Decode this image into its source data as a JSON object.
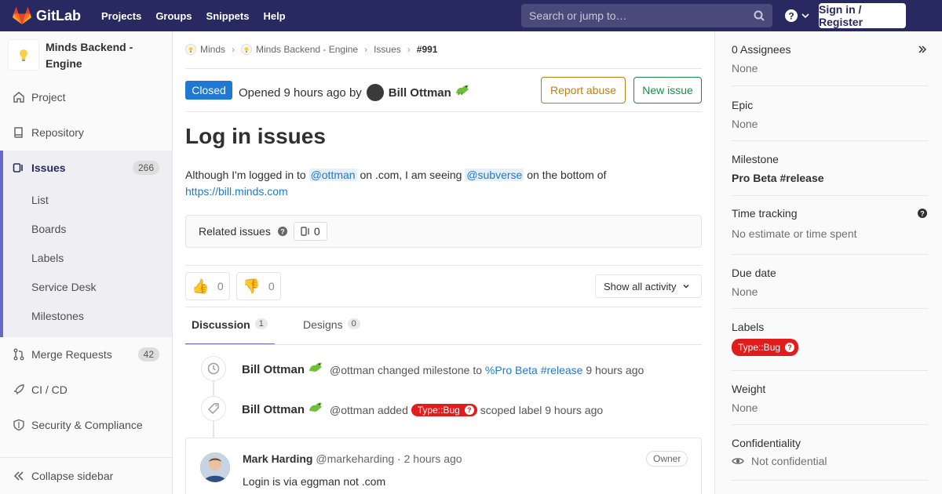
{
  "app": {
    "name": "GitLab"
  },
  "topnav": {
    "links": [
      "Projects",
      "Groups",
      "Snippets",
      "Help"
    ],
    "search_placeholder": "Search or jump to…",
    "signin": "Sign in / Register"
  },
  "sidebar": {
    "project_name": "Minds Backend - Engine",
    "items": {
      "project": "Project",
      "repository": "Repository",
      "issues": "Issues",
      "issues_count": "266",
      "merge_requests": "Merge Requests",
      "merge_requests_count": "42",
      "cicd": "CI / CD",
      "security": "Security & Compliance"
    },
    "issue_subitems": [
      "List",
      "Boards",
      "Labels",
      "Service Desk",
      "Milestones"
    ],
    "collapse": "Collapse sidebar"
  },
  "breadcrumb": [
    "Minds",
    "Minds Backend - Engine",
    "Issues",
    "#991"
  ],
  "issue": {
    "status": "Closed",
    "opened_text": "Opened 9 hours ago by",
    "author": "Bill Ottman",
    "report_abuse": "Report abuse",
    "new_issue": "New issue",
    "title": "Log in issues",
    "desc_1": "Although I'm logged in to",
    "mention_1": "@ottman",
    "desc_2": "on .com, I am seeing",
    "mention_2": "@subverse",
    "desc_3": "on the bottom of",
    "link": "https://bill.minds.com",
    "related_label": "Related issues",
    "related_count": "0",
    "thumbs_up": "0",
    "thumbs_down": "0",
    "activity_filter": "Show all activity"
  },
  "tabs": {
    "discussion": "Discussion",
    "discussion_count": "1",
    "designs": "Designs",
    "designs_count": "0"
  },
  "timeline": [
    {
      "author": "Bill Ottman",
      "handle": "@ottman",
      "action": "changed milestone to",
      "target": "%Pro Beta #release",
      "time": "9 hours ago"
    },
    {
      "author": "Bill Ottman",
      "handle": "@ottman",
      "action": "added",
      "label": "Type::Bug",
      "suffix": "scoped label",
      "time": "9 hours ago"
    }
  ],
  "note": {
    "author": "Mark Harding",
    "handle": "@markeharding · 2 hours ago",
    "role": "Owner",
    "body": "Login is via eggman not .com"
  },
  "right_sidebar": {
    "assignees_title": "0 Assignees",
    "assignees_value": "None",
    "epic_title": "Epic",
    "epic_value": "None",
    "milestone_title": "Milestone",
    "milestone_value": "Pro Beta #release",
    "time_title": "Time tracking",
    "time_value": "No estimate or time spent",
    "due_title": "Due date",
    "due_value": "None",
    "labels_title": "Labels",
    "label_value": "Type::Bug",
    "weight_title": "Weight",
    "weight_value": "None",
    "confidentiality_title": "Confidentiality",
    "confidentiality_value": "Not confidential"
  },
  "colors": {
    "nav_bg": "#292961",
    "closed_blue": "#1f78d1",
    "label_red": "#e21b1b",
    "report_orange": "#c17d10",
    "new_issue_green": "#168f48"
  }
}
